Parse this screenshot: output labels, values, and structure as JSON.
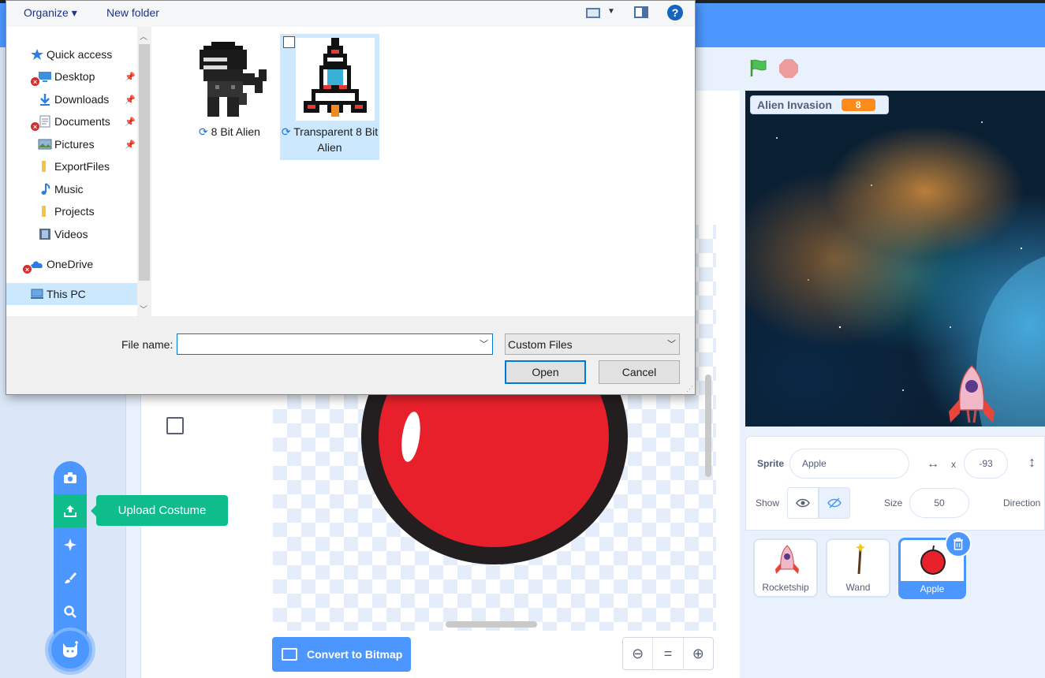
{
  "dialog": {
    "toolbar": {
      "organize": "Organize ▾",
      "new_folder": "New folder",
      "help": "?"
    },
    "nav": [
      {
        "label": "Quick access",
        "icon": "star-icon"
      },
      {
        "label": "Desktop",
        "icon": "desktop-icon",
        "pinned": true,
        "error": true
      },
      {
        "label": "Downloads",
        "icon": "download-arrow-icon",
        "pinned": true
      },
      {
        "label": "Documents",
        "icon": "documents-icon",
        "pinned": true,
        "error": true
      },
      {
        "label": "Pictures",
        "icon": "pictures-icon",
        "pinned": true
      },
      {
        "label": "ExportFiles",
        "icon": "folder-icon"
      },
      {
        "label": "Music",
        "icon": "music-note-icon"
      },
      {
        "label": "Projects",
        "icon": "folder-icon"
      },
      {
        "label": "Videos",
        "icon": "film-icon"
      },
      {
        "label": "OneDrive",
        "icon": "cloud-icon",
        "error": true
      },
      {
        "label": "This PC",
        "icon": "computer-icon",
        "selected": true
      }
    ],
    "files": [
      {
        "name": "8 Bit Alien",
        "thumbnail": "alien-pixel-art-icon",
        "selected": false
      },
      {
        "name": "Transparent 8 Bit Alien",
        "thumbnail": "rocket-pixel-art-icon",
        "selected": true
      }
    ],
    "file_name_label": "File name:",
    "file_name_value": "",
    "filter_selected": "Custom Files",
    "open_label": "Open",
    "cancel_label": "Cancel"
  },
  "editor": {
    "upload_tooltip": "Upload Costume",
    "convert_label": "Convert to Bitmap",
    "zoom": {
      "out": "⊖",
      "reset": "=",
      "in": "⊕"
    }
  },
  "stage": {
    "variable_name": "Alien Invasion",
    "variable_value": "8"
  },
  "sprite_info": {
    "sprite_label": "Sprite",
    "sprite_name": "Apple",
    "x_label": "x",
    "x_value": "-93",
    "show_label": "Show",
    "size_label": "Size",
    "size_value": "50",
    "direction_label": "Direction"
  },
  "sprites": [
    {
      "name": "Rocketship",
      "icon": "rocket-icon"
    },
    {
      "name": "Wand",
      "icon": "wand-icon"
    },
    {
      "name": "Apple",
      "icon": "apple-icon",
      "selected": true
    }
  ],
  "colors": {
    "scratch_blue": "#4c97ff",
    "upload_green": "#0fbd8c",
    "variable_orange": "#ff8c1a",
    "apple_red": "#e8202b",
    "dialog_selection": "#cce8ff"
  }
}
